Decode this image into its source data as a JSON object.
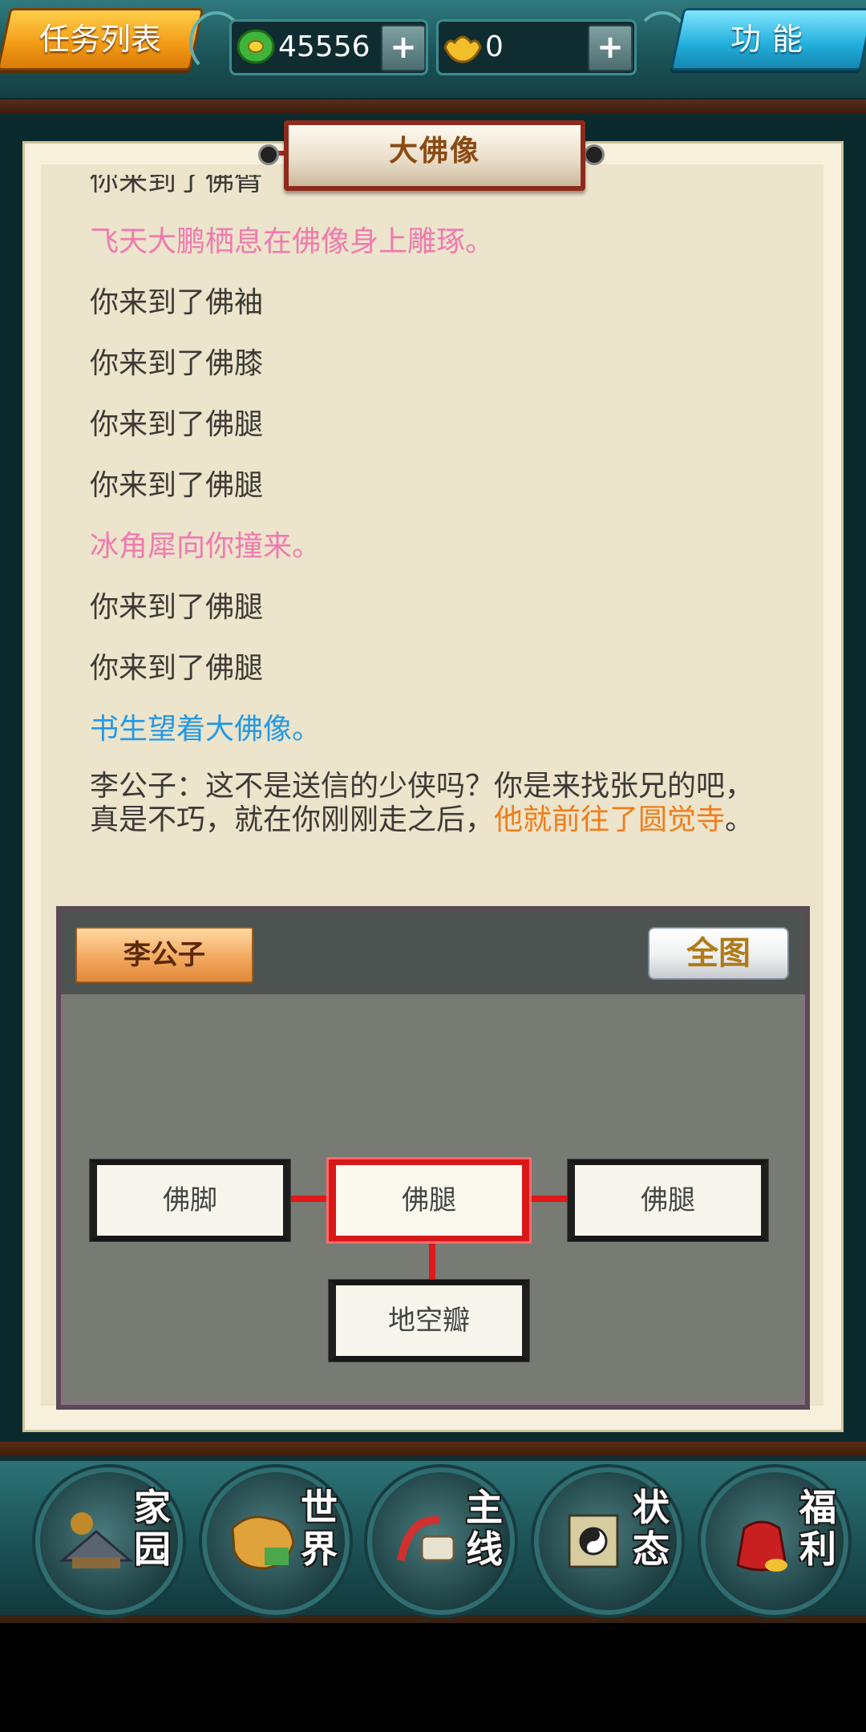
{
  "top_bar": {
    "task_list_label": "任务列表",
    "coins_value": "45556",
    "ingots_value": "0",
    "plus_label": "+",
    "function_label": "功能"
  },
  "panel": {
    "title": "大佛像"
  },
  "log": {
    "lines": [
      "你来到了佛臂",
      "飞天大鹏栖息在佛像身上雕琢。",
      "你来到了佛袖",
      "你来到了佛膝",
      "你来到了佛腿",
      "你来到了佛腿",
      "冰角犀向你撞来。",
      "你来到了佛腿",
      "你来到了佛腿",
      "书生望着大佛像。"
    ],
    "dialog_normal": "李公子：这不是送信的少侠吗？你是来找张兄的吧，真是不巧，就在你刚刚走之后，",
    "dialog_highlight": "他就前往了圆觉寺",
    "dialog_end": "。"
  },
  "map": {
    "npc_button": "李公子",
    "full_map_button": "全图",
    "nodes": {
      "left": "佛脚",
      "center": "佛腿",
      "right": "佛腿",
      "bottom": "地空瓣"
    }
  },
  "bottom_nav": [
    {
      "label_1": "家",
      "label_2": "园"
    },
    {
      "label_1": "世",
      "label_2": "界"
    },
    {
      "label_1": "主",
      "label_2": "线"
    },
    {
      "label_1": "状",
      "label_2": "态"
    },
    {
      "label_1": "福",
      "label_2": "利"
    }
  ],
  "colors": {
    "highlight_pink": "#f07ab0",
    "highlight_blue": "#2399e6",
    "highlight_orange": "#ef7d1a",
    "active_path_red": "#e01818"
  }
}
